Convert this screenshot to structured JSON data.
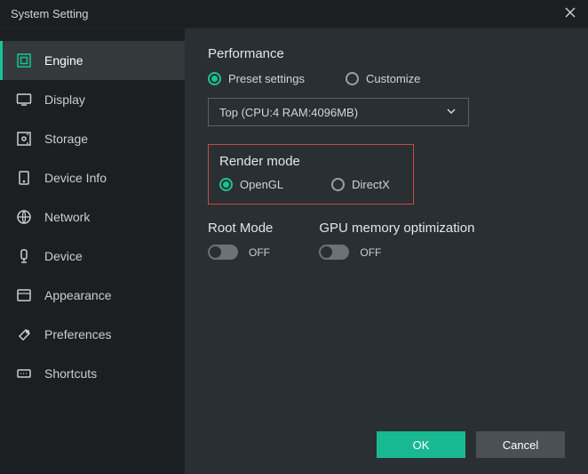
{
  "titlebar": {
    "title": "System Setting"
  },
  "sidebar": {
    "items": [
      {
        "label": "Engine"
      },
      {
        "label": "Display"
      },
      {
        "label": "Storage"
      },
      {
        "label": "Device Info"
      },
      {
        "label": "Network"
      },
      {
        "label": "Device"
      },
      {
        "label": "Appearance"
      },
      {
        "label": "Preferences"
      },
      {
        "label": "Shortcuts"
      }
    ]
  },
  "performance": {
    "title": "Performance",
    "preset_label": "Preset settings",
    "customize_label": "Customize",
    "selected_preset": "Top (CPU:4 RAM:4096MB)"
  },
  "render": {
    "title": "Render mode",
    "opengl_label": "OpenGL",
    "directx_label": "DirectX"
  },
  "root": {
    "title": "Root Mode",
    "state": "OFF"
  },
  "gpu": {
    "title": "GPU memory optimization",
    "state": "OFF"
  },
  "footer": {
    "ok": "OK",
    "cancel": "Cancel"
  }
}
